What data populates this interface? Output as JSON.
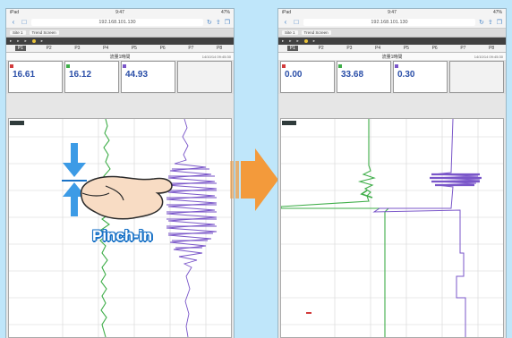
{
  "left_screen": {
    "status_left": "iPad",
    "status_time": "9:47",
    "status_right": "47%",
    "url": "192.168.101.130",
    "app_tabs": [
      "Site 1",
      "Trend Screen"
    ],
    "panel_values": [
      "16.61",
      "16.12",
      "44.93",
      ""
    ],
    "p_tabs": [
      "P1",
      "P2",
      "P3",
      "P4",
      "P5",
      "P6",
      "P7",
      "P8"
    ],
    "chart_title": "流量1時間",
    "timestamp": "14/10/14 09:45:30"
  },
  "right_screen": {
    "status_left": "iPad",
    "status_time": "9:47",
    "status_right": "47%",
    "url": "192.168.101.130",
    "app_tabs": [
      "Site 1",
      "Trend Screen"
    ],
    "panel_values": [
      "0.00",
      "33.68",
      "0.30",
      ""
    ],
    "p_tabs": [
      "P1",
      "P2",
      "P3",
      "P4",
      "P5",
      "P6",
      "P7",
      "P8"
    ],
    "chart_title": "流量1時間",
    "timestamp": "14/10/14 09:45:30"
  },
  "gesture_label": "Pinch-in",
  "colors": {
    "background": "#bfe6fa",
    "green_trace": "#3fae49",
    "purple_trace": "#7a56c9",
    "arrow": "#f39a3b",
    "pinch_blue": "#1a73c7"
  }
}
